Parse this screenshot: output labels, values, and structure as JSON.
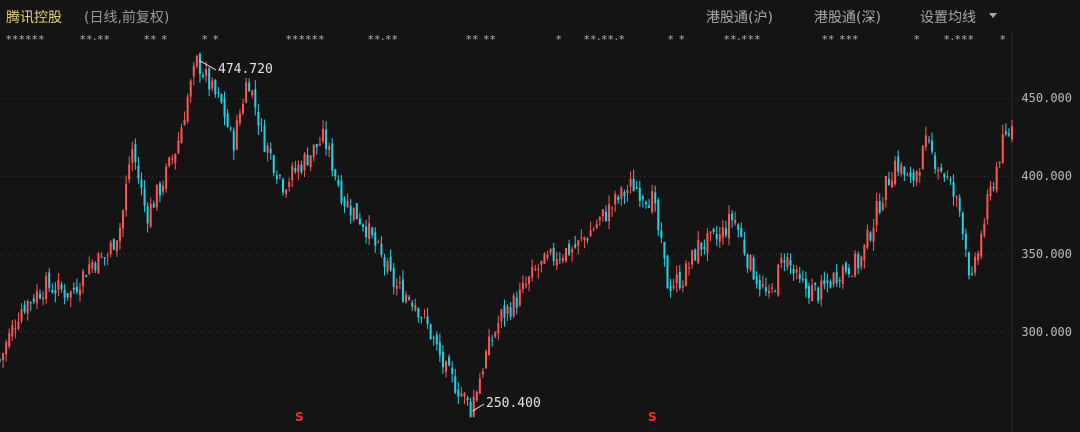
{
  "header": {
    "title": "腾讯控股",
    "subtitle": "(日线,前复权)",
    "buttons": [
      "港股通(沪)",
      "港股通(深)",
      "设置均线"
    ]
  },
  "legend_row": [
    "******",
    "**·**",
    "** *",
    "* *",
    "******",
    "**·**",
    "** **",
    "*",
    "**·**·*",
    "* *",
    "**·***",
    "** ***",
    "*",
    "*·***",
    "*"
  ],
  "markers": {
    "dividend_label": "S",
    "dividend_dates": [
      0.275,
      0.602
    ]
  },
  "colors": {
    "up": "#ff5757",
    "down": "#22d3e6",
    "grid": "#3a3a3a",
    "marker": "#ff2a2a"
  },
  "chart_data": {
    "type": "candlestick",
    "title": "腾讯控股",
    "subtitle": "(日线,前复权)",
    "ylim": [
      245,
      480
    ],
    "yticks": [
      300,
      350,
      400,
      450
    ],
    "ytick_labels": [
      "300.000",
      "350.000",
      "400.000",
      "450.000"
    ],
    "grid": true,
    "annotations": [
      {
        "label": "474.720",
        "value": 474.72,
        "type": "high"
      },
      {
        "label": "250.400",
        "value": 250.4,
        "type": "low"
      }
    ],
    "close_path": [
      [
        0,
        282
      ],
      [
        0.02,
        315
      ],
      [
        0.045,
        330
      ],
      [
        0.07,
        325
      ],
      [
        0.09,
        345
      ],
      [
        0.105,
        348
      ],
      [
        0.12,
        370
      ],
      [
        0.13,
        420
      ],
      [
        0.145,
        375
      ],
      [
        0.16,
        395
      ],
      [
        0.175,
        420
      ],
      [
        0.185,
        450
      ],
      [
        0.195,
        474.72
      ],
      [
        0.21,
        455
      ],
      [
        0.22,
        445
      ],
      [
        0.23,
        420
      ],
      [
        0.245,
        465
      ],
      [
        0.26,
        425
      ],
      [
        0.28,
        395
      ],
      [
        0.3,
        410
      ],
      [
        0.32,
        425
      ],
      [
        0.34,
        385
      ],
      [
        0.36,
        370
      ],
      [
        0.375,
        350
      ],
      [
        0.39,
        330
      ],
      [
        0.41,
        320
      ],
      [
        0.425,
        300
      ],
      [
        0.44,
        275
      ],
      [
        0.455,
        262
      ],
      [
        0.465,
        250.4
      ],
      [
        0.48,
        285
      ],
      [
        0.495,
        310
      ],
      [
        0.51,
        320
      ],
      [
        0.53,
        340
      ],
      [
        0.55,
        350
      ],
      [
        0.57,
        355
      ],
      [
        0.59,
        370
      ],
      [
        0.61,
        385
      ],
      [
        0.625,
        395
      ],
      [
        0.645,
        385
      ],
      [
        0.66,
        330
      ],
      [
        0.675,
        335
      ],
      [
        0.69,
        355
      ],
      [
        0.71,
        360
      ],
      [
        0.725,
        375
      ],
      [
        0.74,
        345
      ],
      [
        0.76,
        320
      ],
      [
        0.775,
        350
      ],
      [
        0.79,
        330
      ],
      [
        0.81,
        325
      ],
      [
        0.83,
        340
      ],
      [
        0.85,
        345
      ],
      [
        0.87,
        385
      ],
      [
        0.885,
        410
      ],
      [
        0.9,
        395
      ],
      [
        0.915,
        420
      ],
      [
        0.935,
        400
      ],
      [
        0.95,
        375
      ],
      [
        0.96,
        330
      ],
      [
        0.975,
        380
      ],
      [
        0.99,
        420
      ],
      [
        1,
        432
      ]
    ]
  }
}
